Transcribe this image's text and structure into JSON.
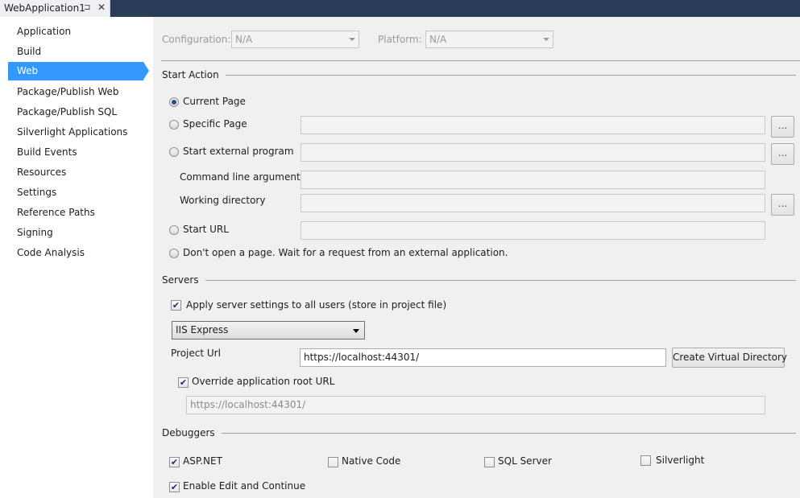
{
  "tab": {
    "title": "WebApplication1",
    "pin_icon": "⊐",
    "close_icon": "✕"
  },
  "sidebar": {
    "items": [
      {
        "label": "Application"
      },
      {
        "label": "Build"
      },
      {
        "label": "Web",
        "selected": true
      },
      {
        "label": "Package/Publish Web"
      },
      {
        "label": "Package/Publish SQL"
      },
      {
        "label": "Silverlight Applications"
      },
      {
        "label": "Build Events"
      },
      {
        "label": "Resources"
      },
      {
        "label": "Settings"
      },
      {
        "label": "Reference Paths"
      },
      {
        "label": "Signing"
      },
      {
        "label": "Code Analysis"
      }
    ]
  },
  "config": {
    "configuration_label": "Configuration:",
    "configuration_value": "N/A",
    "platform_label": "Platform:",
    "platform_value": "N/A"
  },
  "start_action": {
    "title": "Start Action",
    "current_page": "Current Page",
    "specific_page": "Specific Page",
    "start_external": "Start external program",
    "command_line_args": "Command line arguments",
    "working_directory": "Working directory",
    "start_url": "Start URL",
    "dont_open": "Don't open a page.  Wait for a request from an external application.",
    "browse_label": "...",
    "selected": "current_page"
  },
  "servers": {
    "title": "Servers",
    "apply_all_users": "Apply server settings to all users (store in project file)",
    "apply_all_users_checked": true,
    "server_select": "IIS Express",
    "project_url_label": "Project Url",
    "project_url_value": "https://localhost:44301/",
    "create_vdir_button": "Create Virtual Directory",
    "override_root": "Override application root URL",
    "override_root_checked": true,
    "override_root_value": "https://localhost:44301/"
  },
  "debuggers": {
    "title": "Debuggers",
    "aspnet": "ASP.NET",
    "aspnet_checked": true,
    "native_code": "Native Code",
    "native_code_checked": false,
    "sql_server": "SQL Server",
    "sql_server_checked": false,
    "silverlight": "Silverlight",
    "silverlight_checked": false,
    "edit_continue": "Enable Edit and Continue",
    "edit_continue_checked": true,
    "check_glyph": "✔"
  },
  "colors": {
    "accent": "#3399ff",
    "tabstrip": "#2b3c59"
  }
}
